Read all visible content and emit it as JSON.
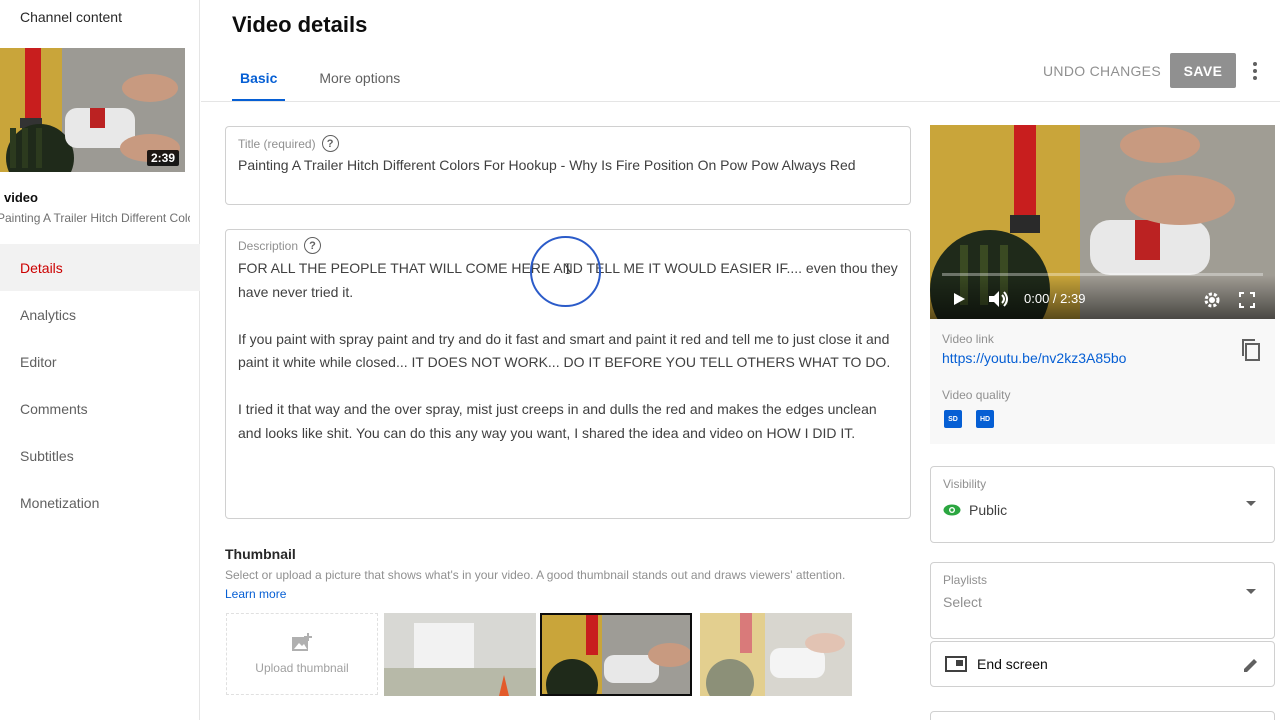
{
  "sidebar": {
    "back_label": "Channel content",
    "thumbnail_duration": "2:39",
    "video_label": "video",
    "video_title": "Painting A Trailer Hitch Different Colors For Hookup",
    "nav": [
      {
        "label": "Details",
        "active": true
      },
      {
        "label": "Analytics"
      },
      {
        "label": "Editor"
      },
      {
        "label": "Comments"
      },
      {
        "label": "Subtitles"
      },
      {
        "label": "Monetization"
      }
    ]
  },
  "header": {
    "title": "Video details",
    "tabs": [
      "Basic",
      "More options"
    ],
    "undo_label": "UNDO CHANGES",
    "save_label": "SAVE"
  },
  "title_field": {
    "label": "Title (required)",
    "value": "Painting A Trailer Hitch Different Colors For Hookup - Why Is Fire Position On Pow Pow Always Red"
  },
  "description_field": {
    "label": "Description",
    "paragraphs": [
      "FOR ALL THE PEOPLE THAT WILL COME HERE AND TELL ME IT WOULD EASIER IF....  even thou they have never tried it.",
      "If you paint with spray paint and try and do it fast and smart and paint it red and tell me to just close it and paint it white while closed... IT DOES NOT WORK... DO IT BEFORE YOU TELL OTHERS WHAT TO DO.",
      "I tried it that way and the over spray, mist just creeps in and dulls the red and makes the edges unclean and looks like shit.  You can do this any way you want, I shared the idea and video on HOW I DID IT."
    ]
  },
  "thumbnail": {
    "heading": "Thumbnail",
    "subtitle": "Select or upload a picture that shows what's in your video. A good thumbnail stands out and draws viewers' attention.",
    "learn_more": "Learn more",
    "upload_label": "Upload thumbnail"
  },
  "player": {
    "time": "0:00 / 2:39"
  },
  "video_info": {
    "link_label": "Video link",
    "link": "https://youtu.be/nv2kz3A85bo",
    "quality_label": "Video quality",
    "badges": [
      "SD",
      "HD"
    ]
  },
  "visibility": {
    "label": "Visibility",
    "value": "Public"
  },
  "playlists": {
    "label": "Playlists",
    "value": "Select"
  },
  "end_screen": {
    "label": "End screen"
  },
  "colors": {
    "accent_blue": "#065fd4",
    "active_red": "#cc0000",
    "public_green": "#2ba640"
  }
}
